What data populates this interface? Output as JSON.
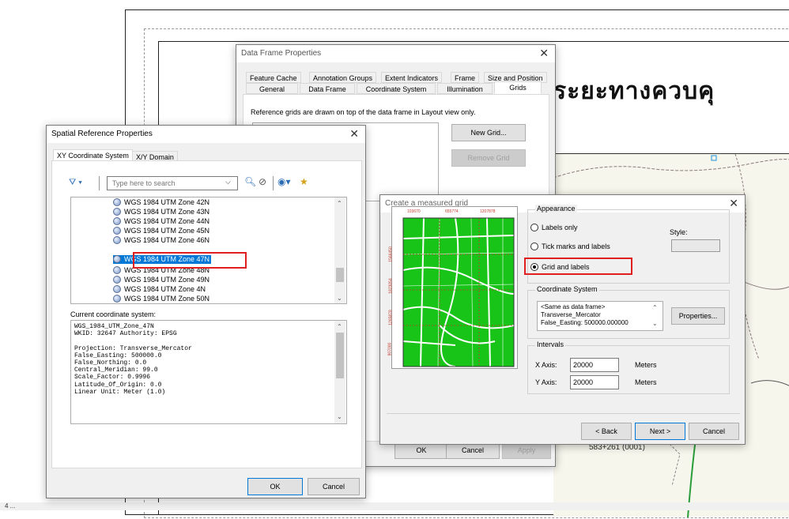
{
  "layout": {
    "thai_title": "ระยะทางควบคุ",
    "station_label": "583+261 (0001)",
    "status_strip_label": "4 ..."
  },
  "data_frame_properties": {
    "title": "Data Frame Properties",
    "tabs_row1": [
      "Feature Cache",
      "Annotation Groups",
      "Extent Indicators",
      "Frame",
      "Size and Position"
    ],
    "tabs_row2": [
      "General",
      "Data Frame",
      "Coordinate System",
      "Illumination",
      "Grids"
    ],
    "active_tab": "Grids",
    "description": "Reference grids are drawn on top of the data frame in Layout view only.",
    "buttons": {
      "new_grid": "New Grid...",
      "remove_grid": "Remove Grid",
      "ok": "OK",
      "cancel": "Cancel",
      "apply": "Apply"
    }
  },
  "spatial_reference": {
    "title": "Spatial Reference Properties",
    "tabs": [
      "XY Coordinate System",
      "X/Y Domain"
    ],
    "search_placeholder": "Type here to search",
    "coordinate_systems": [
      "WGS 1984 UTM Zone 42N",
      "WGS 1984 UTM Zone 43N",
      "WGS 1984 UTM Zone 44N",
      "WGS 1984 UTM Zone 45N",
      "WGS 1984 UTM Zone 46N",
      "WGS 1984 UTM Zone 47N",
      "WGS 1984 UTM Zone 48N",
      "WGS 1984 UTM Zone 49N",
      "WGS 1984 UTM Zone 4N",
      "WGS 1984 UTM Zone 50N"
    ],
    "selected": "WGS 1984 UTM Zone 47N",
    "current_label": "Current coordinate system:",
    "current_details": "WGS_1984_UTM_Zone_47N\nWKID: 32647 Authority: EPSG\n\nProjection: Transverse_Mercator\nFalse_Easting: 500000.0\nFalse_Northing: 0.0\nCentral_Meridian: 99.0\nScale_Factor: 0.9996\nLatitude_Of_Origin: 0.0\nLinear Unit: Meter (1.0)",
    "ok": "OK",
    "cancel": "Cancel"
  },
  "measured_grid": {
    "title": "Create a measured grid",
    "preview_ticks_top": [
      "103670",
      "655774",
      "1207878"
    ],
    "preview_ticks_left": [
      "1566450",
      "1823054",
      "1265878",
      "907000"
    ],
    "appearance_title": "Appearance",
    "options": [
      "Labels only",
      "Tick marks and labels",
      "Grid and labels"
    ],
    "selected_option": "Grid and labels",
    "style_label": "Style:",
    "cs_title": "Coordinate System",
    "cs_details": "<Same as data frame>\nTransverse_Mercator\nFalse_Easting: 500000.000000",
    "properties_button": "Properties...",
    "intervals_title": "Intervals",
    "x_axis_label": "X Axis:",
    "x_axis_value": "20000",
    "y_axis_label": "Y Axis:",
    "y_axis_value": "20000",
    "unit": "Meters",
    "back": "< Back",
    "next": "Next >",
    "cancel": "Cancel"
  }
}
